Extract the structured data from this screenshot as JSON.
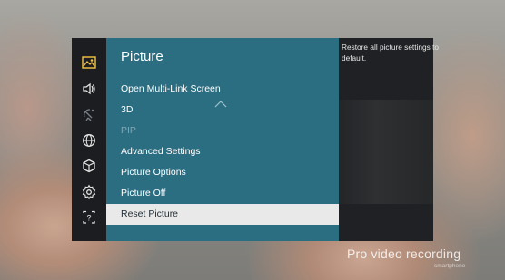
{
  "sidebar": {
    "icons": [
      {
        "name": "picture-icon",
        "active": true
      },
      {
        "name": "sound-icon",
        "active": false
      },
      {
        "name": "broadcasting-icon",
        "active": false
      },
      {
        "name": "network-icon",
        "active": false
      },
      {
        "name": "system-icon",
        "active": false
      },
      {
        "name": "settings-gear-icon",
        "active": false
      },
      {
        "name": "support-icon",
        "active": false
      }
    ],
    "icon_color": "#e6e6e6",
    "active_color": "#f4c542"
  },
  "menu": {
    "title": "Picture",
    "items": [
      {
        "label": "Open Multi-Link Screen",
        "state": "normal"
      },
      {
        "label": "3D",
        "state": "normal"
      },
      {
        "label": "PIP",
        "state": "disabled"
      },
      {
        "label": "Advanced Settings",
        "state": "normal"
      },
      {
        "label": "Picture Options",
        "state": "normal"
      },
      {
        "label": "Picture Off",
        "state": "normal"
      },
      {
        "label": "Reset Picture",
        "state": "selected"
      }
    ],
    "panel_color": "#2b6e82",
    "selected_color": "#e9e9e9"
  },
  "help": {
    "text": "Restore all picture settings to default."
  },
  "watermark": {
    "main": "Pro video recording",
    "sub": "smartphone"
  }
}
